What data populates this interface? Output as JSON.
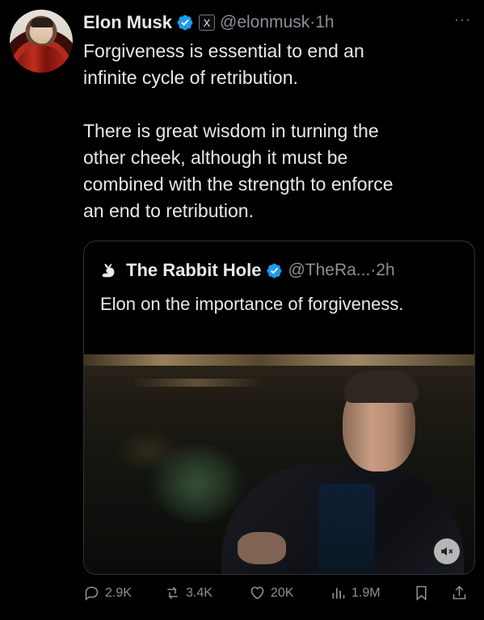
{
  "author": {
    "name": "Elon Musk",
    "handle": "@elonmusk",
    "time": "·1h",
    "avatar_icon": "avatar-red-suit",
    "affiliate_badge": "X"
  },
  "tweet": {
    "text": "Forgiveness is essential to end an\ninfinite cycle of retribution.\n\nThere is great wisdom in turning the\nother cheek, although it must be\ncombined with the strength to enforce\nan end to retribution."
  },
  "quoted": {
    "name": "The Rabbit Hole",
    "handle": "@TheRa...",
    "time": "·2h",
    "text": "Elon on the importance of forgiveness.",
    "media_icon": "video-mute-icon"
  },
  "actions": {
    "replies": "2.9K",
    "reposts": "3.4K",
    "likes": "20K",
    "views": "1.9M"
  },
  "colors": {
    "background": "#000000",
    "text": "#e7e9ea",
    "muted": "#8b9096",
    "verified": "#1d9bf0",
    "border": "#2f3336"
  }
}
